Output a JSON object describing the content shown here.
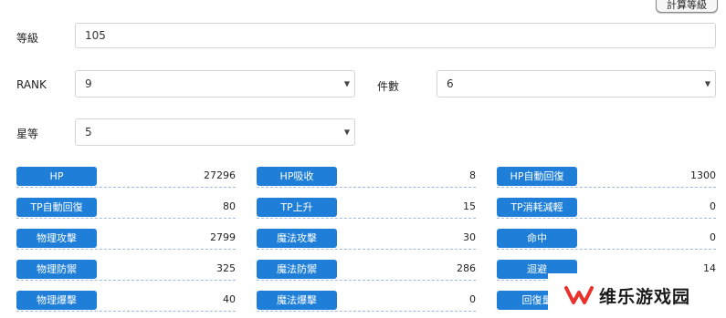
{
  "calc_button_label": "計算等級",
  "form": {
    "level": {
      "label": "等級",
      "value": "105"
    },
    "rank": {
      "label": "RANK",
      "value": "9"
    },
    "pieces": {
      "label": "件數",
      "value": "6"
    },
    "stars": {
      "label": "星等",
      "value": "5"
    }
  },
  "stats": [
    {
      "label": "HP",
      "value": "27296"
    },
    {
      "label": "HP吸收",
      "value": "8"
    },
    {
      "label": "HP自動回復",
      "value": "1300"
    },
    {
      "label": "TP自動回復",
      "value": "80"
    },
    {
      "label": "TP上升",
      "value": "15"
    },
    {
      "label": "TP消耗減輕",
      "value": "0"
    },
    {
      "label": "物理攻擊",
      "value": "2799"
    },
    {
      "label": "魔法攻擊",
      "value": "30"
    },
    {
      "label": "命中",
      "value": "0"
    },
    {
      "label": "物理防禦",
      "value": "325"
    },
    {
      "label": "魔法防禦",
      "value": "286"
    },
    {
      "label": "迴避",
      "value": "14"
    },
    {
      "label": "物理爆擊",
      "value": "40"
    },
    {
      "label": "魔法爆擊",
      "value": "0"
    },
    {
      "label": "回復量",
      "value": ""
    }
  ],
  "watermark": {
    "text": "维乐游戏园",
    "accent": "#e8322b"
  },
  "colors": {
    "stat_label_bg": "#1f7fd8",
    "dashed_line": "#9fbbe0"
  }
}
